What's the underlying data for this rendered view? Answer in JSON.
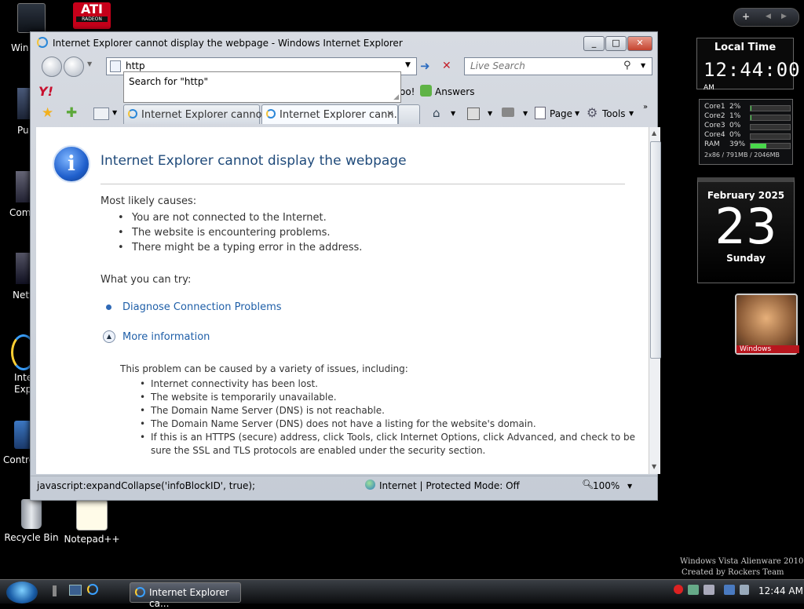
{
  "desktop": {
    "icons": [
      {
        "label": "Recycle Bin"
      },
      {
        "label": "Notepad++"
      }
    ],
    "partial_labels": [
      "Win",
      "Pu",
      "Com",
      "Netw",
      "Inte",
      "Exp",
      "Contro"
    ],
    "ati_logo": {
      "line1": "ATI",
      "line2": "RADEON"
    },
    "watermark": {
      "line1": "Windows Vista Alienware 2010",
      "line2": "Created by Rockers Team"
    }
  },
  "sidebar": {
    "nav": {
      "add": "+",
      "prev": "◀",
      "next": "▶"
    },
    "local_time": {
      "title": "Local Time",
      "time": "12:44:00",
      "ampm": "AM"
    },
    "cpu": {
      "rows": [
        {
          "label": "Core1",
          "value": "2%",
          "fill": 0.02
        },
        {
          "label": "Core2",
          "value": "1%",
          "fill": 0.01
        },
        {
          "label": "Core3",
          "value": "0%",
          "fill": 0.0
        },
        {
          "label": "Core4",
          "value": "0%",
          "fill": 0.0
        },
        {
          "label": "RAM",
          "value": "39%",
          "fill": 0.39
        }
      ],
      "footer": "2x86 / 791MB / 2046MB"
    },
    "calendar": {
      "month_year": "February 2025",
      "day": "23",
      "weekday": "Sunday"
    },
    "photo": {
      "caption": "Windows"
    }
  },
  "ie": {
    "title": "Internet Explorer cannot display the webpage - Windows Internet Explorer",
    "address": "http",
    "autocomplete": "Search for \"http\"",
    "search_placeholder": "Live Search",
    "links": {
      "yahoo_partial": "oo!",
      "answers": "Answers"
    },
    "tabs": [
      {
        "label": "Internet Explorer cannot d...",
        "active": false
      },
      {
        "label": "Internet Explorer cann...",
        "active": true
      }
    ],
    "toolbar": {
      "page": "Page",
      "tools": "Tools"
    },
    "page": {
      "heading": "Internet Explorer cannot display the webpage",
      "causes_title": "Most likely causes:",
      "causes": [
        "You are not connected to the Internet.",
        "The website is encountering problems.",
        "There might be a typing error in the address."
      ],
      "try_title": "What you can try:",
      "diagnose": "Diagnose Connection Problems",
      "more_info": "More information",
      "detail_intro": "This problem can be caused by a variety of issues, including:",
      "details": [
        "Internet connectivity has been lost.",
        "The website is temporarily unavailable.",
        "The Domain Name Server (DNS) is not reachable.",
        "The Domain Name Server (DNS) does not have a listing for the website's domain.",
        "If this is an HTTPS (secure) address, click Tools, click Internet Options, click Advanced, and check to be",
        "sure the SSL and TLS protocols are enabled under the security section."
      ]
    },
    "status": {
      "text": "javascript:expandCollapse('infoBlockID', true);",
      "zone": "Internet | Protected Mode: Off",
      "zoom": "100%"
    }
  },
  "taskbar": {
    "task_label": "Internet Explorer ca...",
    "clock": "12:44 AM"
  },
  "colors": {
    "accent": "#1f4a7a",
    "link": "#1f5fa8",
    "gauge_green": "#49d84b"
  }
}
